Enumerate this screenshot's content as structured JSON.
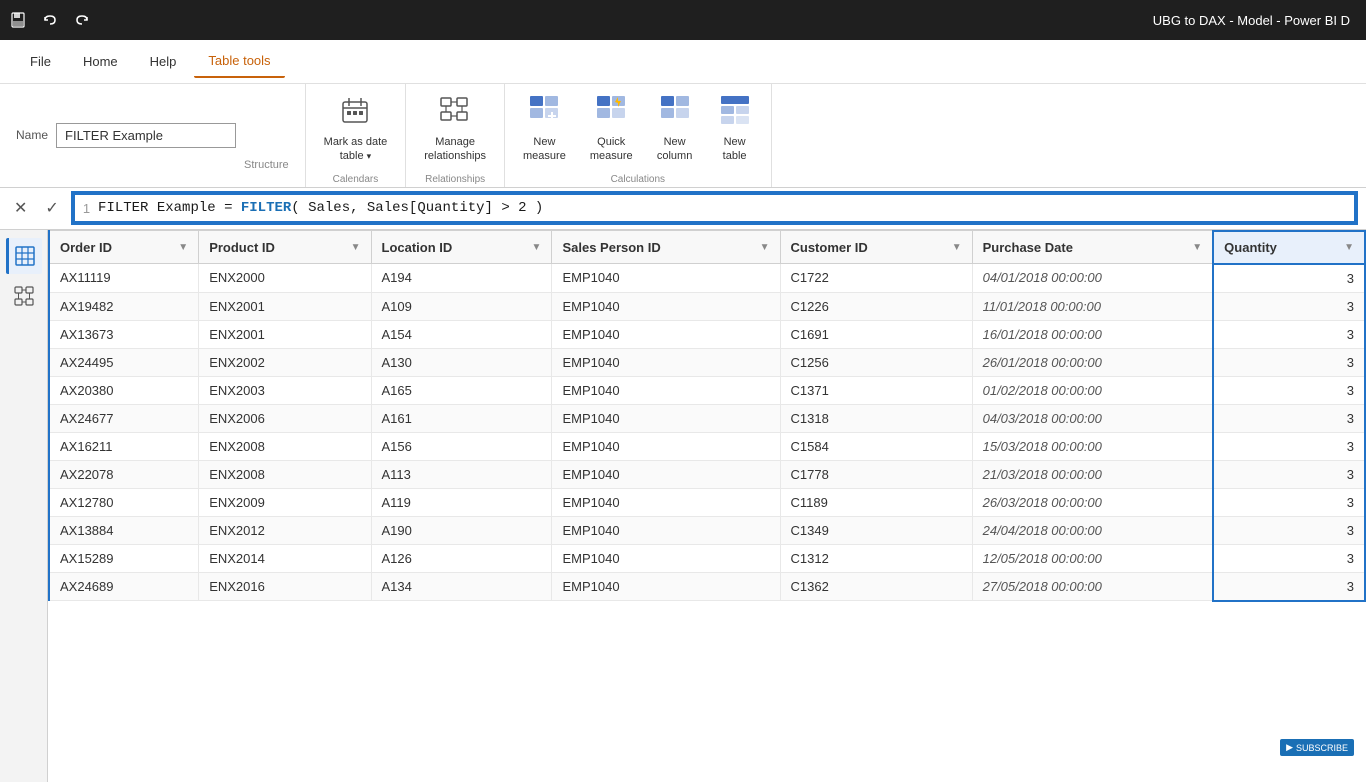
{
  "titleBar": {
    "title": "UBG to DAX - Model - Power BI D",
    "saveLabel": "💾",
    "undoLabel": "↩",
    "redoLabel": "↪"
  },
  "menuBar": {
    "items": [
      {
        "id": "file",
        "label": "File"
      },
      {
        "id": "home",
        "label": "Home"
      },
      {
        "id": "help",
        "label": "Help"
      },
      {
        "id": "table-tools",
        "label": "Table tools",
        "active": true
      }
    ]
  },
  "ribbon": {
    "nameLabel": "Name",
    "nameValue": "FILTER Example",
    "sections": [
      {
        "id": "structure",
        "label": "Structure",
        "buttons": []
      },
      {
        "id": "calendars",
        "label": "Calendars",
        "buttons": [
          {
            "id": "mark-date-table",
            "label": "Mark as date\ntable ▾",
            "icon": "📅"
          }
        ]
      },
      {
        "id": "relationships",
        "label": "Relationships",
        "buttons": [
          {
            "id": "manage-relationships",
            "label": "Manage\nrelationships",
            "icon": "🔗"
          }
        ]
      },
      {
        "id": "calculations",
        "label": "Calculations",
        "buttons": [
          {
            "id": "new-measure",
            "label": "New\nmeasure",
            "icon": "⊞"
          },
          {
            "id": "quick-measure",
            "label": "Quick\nmeasure",
            "icon": "⚡"
          },
          {
            "id": "new-column",
            "label": "New\ncolumn",
            "icon": "⊞"
          },
          {
            "id": "new-table",
            "label": "New\ntable",
            "icon": "⊞"
          }
        ]
      }
    ]
  },
  "formulaBar": {
    "lineNum": "1",
    "formulaText": "FILTER Example = FILTER( Sales, Sales[Quantity] > 2 )"
  },
  "table": {
    "columns": [
      {
        "id": "order-id",
        "label": "Order ID"
      },
      {
        "id": "product-id",
        "label": "Product ID"
      },
      {
        "id": "location-id",
        "label": "Location ID"
      },
      {
        "id": "sales-person-id",
        "label": "Sales Person ID"
      },
      {
        "id": "customer-id",
        "label": "Customer ID"
      },
      {
        "id": "purchase-date",
        "label": "Purchase Date"
      },
      {
        "id": "quantity",
        "label": "Quantity"
      }
    ],
    "rows": [
      {
        "orderId": "AX11119",
        "productId": "ENX2000",
        "locationId": "A194",
        "salesPersonId": "EMP1040",
        "customerId": "C1722",
        "purchaseDate": "04/01/2018 00:00:00",
        "quantity": "3"
      },
      {
        "orderId": "AX19482",
        "productId": "ENX2001",
        "locationId": "A109",
        "salesPersonId": "EMP1040",
        "customerId": "C1226",
        "purchaseDate": "11/01/2018 00:00:00",
        "quantity": "3"
      },
      {
        "orderId": "AX13673",
        "productId": "ENX2001",
        "locationId": "A154",
        "salesPersonId": "EMP1040",
        "customerId": "C1691",
        "purchaseDate": "16/01/2018 00:00:00",
        "quantity": "3"
      },
      {
        "orderId": "AX24495",
        "productId": "ENX2002",
        "locationId": "A130",
        "salesPersonId": "EMP1040",
        "customerId": "C1256",
        "purchaseDate": "26/01/2018 00:00:00",
        "quantity": "3"
      },
      {
        "orderId": "AX20380",
        "productId": "ENX2003",
        "locationId": "A165",
        "salesPersonId": "EMP1040",
        "customerId": "C1371",
        "purchaseDate": "01/02/2018 00:00:00",
        "quantity": "3"
      },
      {
        "orderId": "AX24677",
        "productId": "ENX2006",
        "locationId": "A161",
        "salesPersonId": "EMP1040",
        "customerId": "C1318",
        "purchaseDate": "04/03/2018 00:00:00",
        "quantity": "3"
      },
      {
        "orderId": "AX16211",
        "productId": "ENX2008",
        "locationId": "A156",
        "salesPersonId": "EMP1040",
        "customerId": "C1584",
        "purchaseDate": "15/03/2018 00:00:00",
        "quantity": "3"
      },
      {
        "orderId": "AX22078",
        "productId": "ENX2008",
        "locationId": "A113",
        "salesPersonId": "EMP1040",
        "customerId": "C1778",
        "purchaseDate": "21/03/2018 00:00:00",
        "quantity": "3"
      },
      {
        "orderId": "AX12780",
        "productId": "ENX2009",
        "locationId": "A119",
        "salesPersonId": "EMP1040",
        "customerId": "C1189",
        "purchaseDate": "26/03/2018 00:00:00",
        "quantity": "3"
      },
      {
        "orderId": "AX13884",
        "productId": "ENX2012",
        "locationId": "A190",
        "salesPersonId": "EMP1040",
        "customerId": "C1349",
        "purchaseDate": "24/04/2018 00:00:00",
        "quantity": "3"
      },
      {
        "orderId": "AX15289",
        "productId": "ENX2014",
        "locationId": "A126",
        "salesPersonId": "EMP1040",
        "customerId": "C1312",
        "purchaseDate": "12/05/2018 00:00:00",
        "quantity": "3"
      },
      {
        "orderId": "AX24689",
        "productId": "ENX2016",
        "locationId": "A134",
        "salesPersonId": "EMP1040",
        "customerId": "C1362",
        "purchaseDate": "27/05/2018 00:00:00",
        "quantity": "3"
      }
    ]
  },
  "sidebar": {
    "icons": [
      {
        "id": "table-view",
        "icon": "▦",
        "active": true
      },
      {
        "id": "model-view",
        "icon": "⬡",
        "active": false
      }
    ]
  },
  "subscribeBadge": {
    "text": "SUBSCRIBE"
  }
}
